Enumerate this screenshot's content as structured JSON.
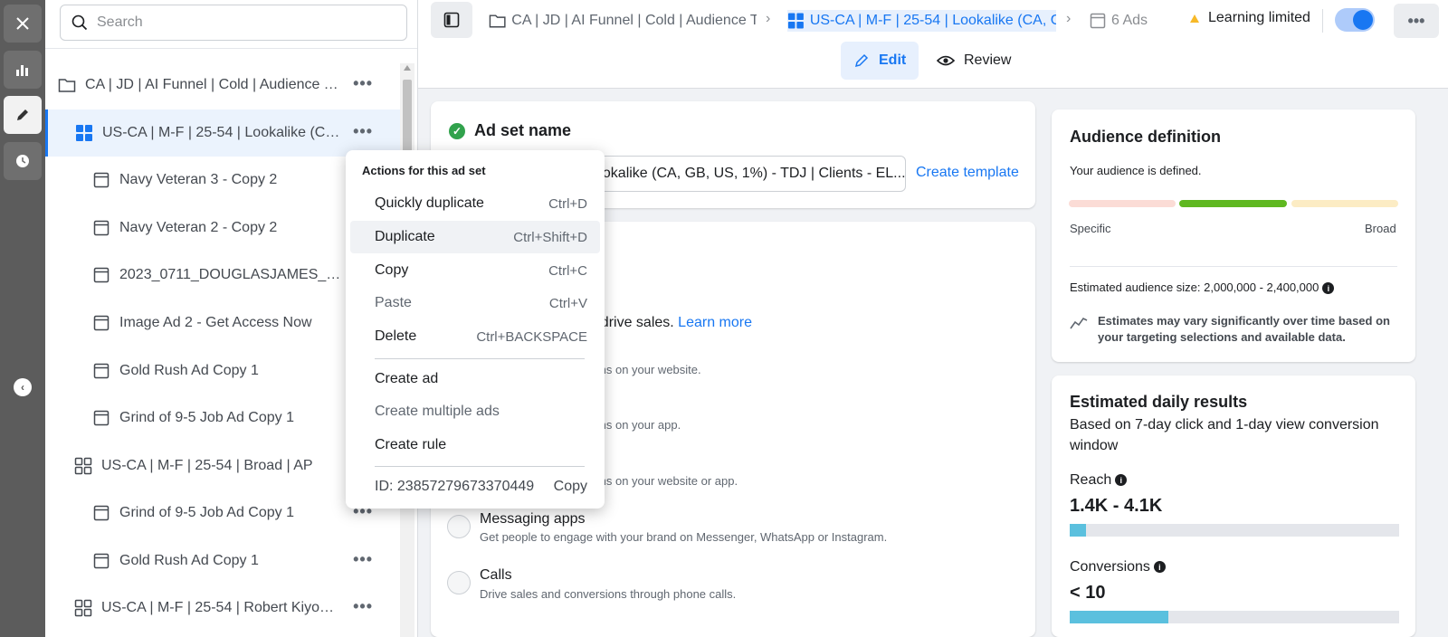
{
  "rail": {
    "close_label": "close-icon",
    "items": [
      "analytics-icon",
      "edit-icon",
      "history-icon"
    ]
  },
  "tree": {
    "search_placeholder": "Search",
    "rows": [
      {
        "label": "CA | JD | AI Funnel | Cold | Audience Te...",
        "type": "campaign"
      },
      {
        "label": "US-CA | M-F | 25-54 | Lookalike (CA, ...",
        "type": "adset-selected"
      },
      {
        "label": "Navy Veteran 3 - Copy 2",
        "type": "ad"
      },
      {
        "label": "Navy Veteran 2 - Copy 2",
        "type": "ad"
      },
      {
        "label": "2023_0711_DOUGLASJAMES_FB...",
        "type": "ad"
      },
      {
        "label": "Image Ad 2 - Get Access Now",
        "type": "ad"
      },
      {
        "label": "Gold Rush Ad Copy 1",
        "type": "ad"
      },
      {
        "label": "Grind of 9-5 Job Ad Copy 1",
        "type": "ad"
      },
      {
        "label": "US-CA | M-F | 25-54 | Broad | AP",
        "type": "adset"
      },
      {
        "label": "Grind of 9-5 Job Ad Copy 1",
        "type": "ad"
      },
      {
        "label": "Gold Rush Ad Copy 1",
        "type": "ad"
      },
      {
        "label": "US-CA | M-F | 25-54 | Robert Kiyosa...",
        "type": "adset"
      }
    ]
  },
  "topbar": {
    "crumb_campaign": "CA | JD | AI Funnel | Cold | Audience Te",
    "crumb_adset": "US-CA | M-F | 25-54 | Lookalike (CA, GB",
    "crumb_ads": "6 Ads",
    "status": "Learning limited",
    "more": "•••"
  },
  "modes": {
    "edit": "Edit",
    "review": "Review"
  },
  "adset_name": {
    "title": "Ad set name",
    "value": "ookalike (CA, GB, US, 1%) - TDJ | Clients - EL...",
    "create_template": "Create template"
  },
  "goal": {
    "drive_sales": "to drive sales.",
    "learn_more": "Learn more",
    "website": "sions on your website.",
    "app": "sions on your app.",
    "website_app": "sions on your website or app.",
    "messaging_title": "Messaging apps",
    "messaging_desc": "Get people to engage with your brand on Messenger, WhatsApp or Instagram.",
    "calls_title": "Calls",
    "calls_desc": "Drive sales and conversions through phone calls."
  },
  "audience": {
    "title": "Audience definition",
    "status": "Your audience is defined.",
    "specific": "Specific",
    "broad": "Broad",
    "size_label": "Estimated audience size: 2,000,000 - 2,400,000",
    "note": "Estimates may vary significantly over time based on your targeting selections and available data.",
    "colors": {
      "specific": "#fbdcd6",
      "defined": "#5fb820",
      "broad": "#fcecc4"
    }
  },
  "daily": {
    "title": "Estimated daily results",
    "subtitle": "Based on 7-day click and 1-day view conversion window",
    "reach_label": "Reach",
    "reach_value": "1.4K - 4.1K",
    "reach_fill": 0.05,
    "conv_label": "Conversions",
    "conv_value": "< 10",
    "conv_fill": 0.3
  },
  "menu": {
    "header": "Actions for this ad set",
    "items": [
      {
        "label": "Quickly duplicate",
        "shortcut": "Ctrl+D"
      },
      {
        "label": "Duplicate",
        "shortcut": "Ctrl+Shift+D"
      },
      {
        "label": "Copy",
        "shortcut": "Ctrl+C"
      },
      {
        "label": "Paste",
        "shortcut": "Ctrl+V"
      },
      {
        "label": "Delete",
        "shortcut": "Ctrl+BACKSPACE"
      },
      {
        "label": "Create ad",
        "shortcut": ""
      },
      {
        "label": "Create multiple ads",
        "shortcut": ""
      },
      {
        "label": "Create rule",
        "shortcut": ""
      }
    ],
    "id_label": "ID: 23857279673370449",
    "id_copy": "Copy"
  }
}
